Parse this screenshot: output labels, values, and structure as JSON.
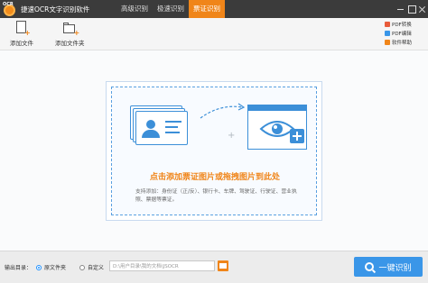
{
  "app": {
    "logo_text": "OCR",
    "title": "捷速OCR文字识别软件"
  },
  "tabs": [
    {
      "label": "高级识别",
      "active": false
    },
    {
      "label": "极速识别",
      "active": false
    },
    {
      "label": "票证识别",
      "active": true
    }
  ],
  "toolbar": {
    "add_file_label": "添加文件",
    "add_folder_label": "添加文件夹"
  },
  "side_links": [
    {
      "label": "PDF转换",
      "icon": "pdf-convert-icon",
      "color": "#e85b3a"
    },
    {
      "label": "PDF编辑",
      "icon": "pdf-edit-icon",
      "color": "#3a96e8"
    },
    {
      "label": "软件帮助",
      "icon": "help-icon",
      "color": "#f08519"
    }
  ],
  "drop_zone": {
    "title": "点击添加票证图片或拖拽图片到此处",
    "description": "支持添加：身份证（正/反）、银行卡、车牌、驾驶证、行驶证、营业执照、票据等票证。"
  },
  "output": {
    "label": "输出目录：",
    "option_source": "原文件夹",
    "option_custom": "自定义",
    "selected": "原文件夹",
    "path": "D:\\用户目录\\我的文档\\JSOCR"
  },
  "action": {
    "ocr_button_label": "一键识别"
  },
  "colors": {
    "accent": "#f08519",
    "primary": "#3a96e8",
    "titlebar": "#3b3b3b"
  }
}
